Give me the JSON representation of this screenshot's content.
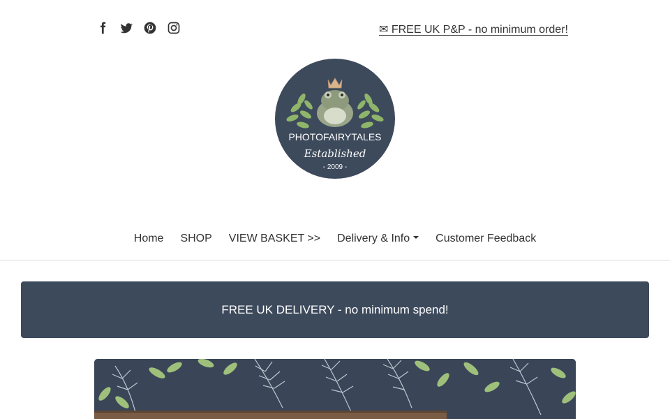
{
  "social": {
    "icons": [
      "facebook-icon",
      "twitter-icon",
      "pinterest-icon",
      "instagram-icon"
    ]
  },
  "header": {
    "promo_link": "✉ FREE UK P&P - no minimum order!"
  },
  "logo": {
    "brand": "PHOTOFAIRYTALES",
    "tagline": "Established",
    "year": "- 2009 -"
  },
  "nav": {
    "items": [
      {
        "label": "Home"
      },
      {
        "label": "SHOP"
      },
      {
        "label": "VIEW BASKET >>"
      },
      {
        "label": "Delivery & Info"
      },
      {
        "label": "Customer Feedback"
      }
    ]
  },
  "banner": {
    "text": "FREE UK DELIVERY - no minimum spend!"
  },
  "colors": {
    "banner_bg": "#3d4a5c",
    "logo_bg": "#3d4a5c",
    "leaf_green": "#8fb56a"
  }
}
